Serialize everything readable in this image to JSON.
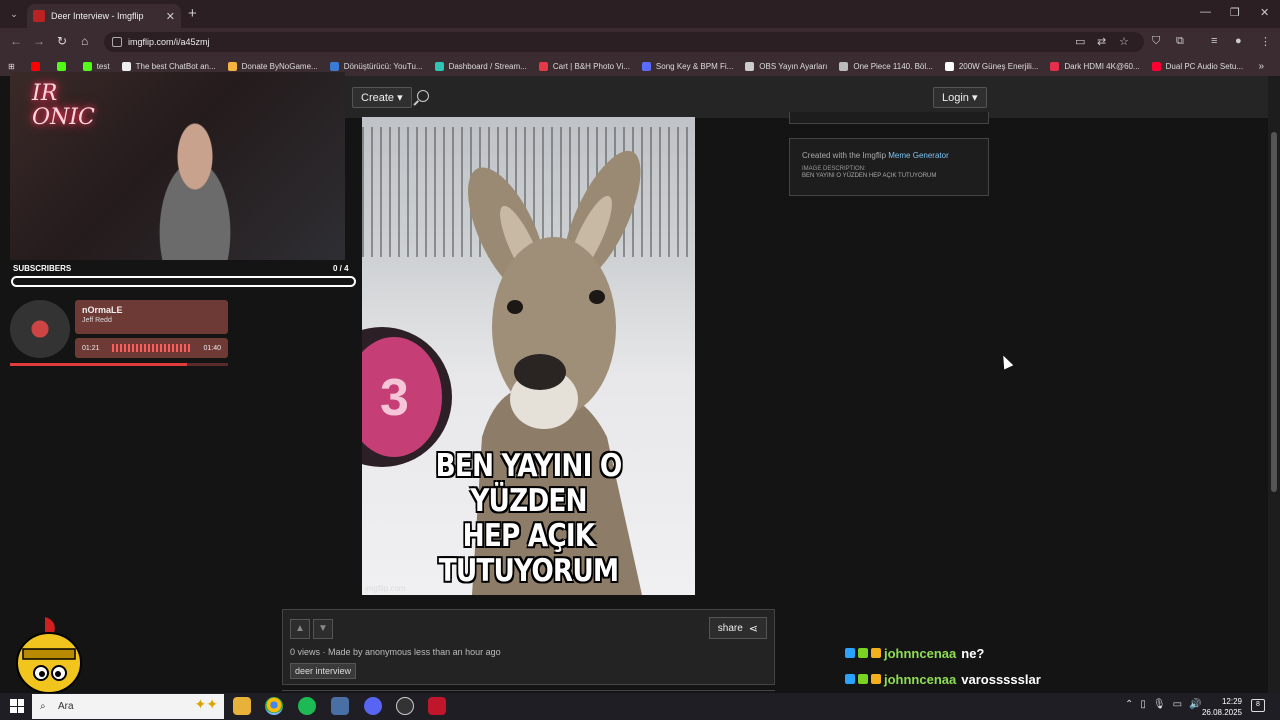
{
  "browser": {
    "tab_title": "Deer Interview - Imgflip",
    "url": "imgflip.com/i/a45zmj",
    "bookmarks": [
      {
        "label": "",
        "color": "#ff0000"
      },
      {
        "label": "",
        "color": "#53fc18"
      },
      {
        "label": "test",
        "color": "#53fc18"
      },
      {
        "label": "The best ChatBot an...",
        "color": "#eeeeee"
      },
      {
        "label": "Donate ByNoGame...",
        "color": "#f5b342"
      },
      {
        "label": "Dönüştürücü: YouTu...",
        "color": "#3a7bd5"
      },
      {
        "label": "Dashboard / Stream...",
        "color": "#2ec4b6"
      },
      {
        "label": "Cart | B&H Photo Vi...",
        "color": "#e63946"
      },
      {
        "label": "Song Key & BPM Fi...",
        "color": "#5c6bff"
      },
      {
        "label": "OBS Yayın Ayarları",
        "color": "#cccccc"
      },
      {
        "label": "One Piece 1140. Böl...",
        "color": "#bbbbbb"
      },
      {
        "label": "200W Güneş Enerjili...",
        "color": "#ffffff"
      },
      {
        "label": "Dark HDMI 4K@60...",
        "color": "#e62e4d"
      },
      {
        "label": "Dual PC Audio Setu...",
        "color": "#ff0033"
      }
    ]
  },
  "site": {
    "create_label": "Create ▾",
    "login_label": "Login ▾",
    "meme_caption_line1": "BEN YAYINI O YÜZDEN",
    "meme_caption_line2": "HEP AÇIK TUTUYORUM",
    "meme_watermark": "imgflip.com",
    "created_prefix": "Created with the Imgflip ",
    "created_link": "Meme Generator",
    "desc_label": "IMAGE DESCRIPTION:",
    "desc_text": "BEN YAYINI O YÜZDEN HEP AÇIK TUTUYORUM",
    "share_label": "share",
    "views_text": "0 views · Made by anonymous less than an hour ago",
    "tag_label": "deer interview"
  },
  "overlay": {
    "neon_line1": "IR",
    "neon_line2": "ONIC",
    "subscribers_label": "SUBSCRIBERS",
    "subscribers_count": "0  / 4",
    "track_title": "nOrmaLE",
    "track_artist": "Jeff Redd",
    "time_elapsed": "01:21",
    "time_total": "01:40",
    "track_progress": 0.81,
    "chat": [
      {
        "user": "johnncenaa",
        "message": "ne?"
      },
      {
        "user": "johnncenaa",
        "message": "varossssslar"
      }
    ]
  },
  "taskbar": {
    "search_placeholder": "Ara",
    "time": "12:29",
    "date": "26.08.2025",
    "notifications": "8"
  }
}
